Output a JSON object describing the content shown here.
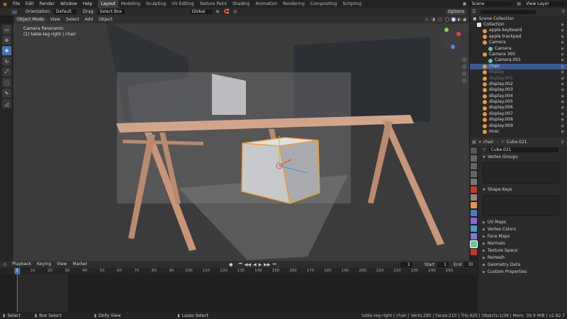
{
  "menubar": {
    "items": [
      "File",
      "Edit",
      "Render",
      "Window",
      "Help"
    ],
    "workspaces": [
      "Layout",
      "Modeling",
      "Sculpting",
      "UV Editing",
      "Texture Paint",
      "Shading",
      "Animation",
      "Rendering",
      "Compositing",
      "Scripting"
    ],
    "active_workspace": "Layout",
    "scene_label": "Scene",
    "view_layer_label": "View Layer"
  },
  "tool_header": {
    "orientation_label": "Orientation:",
    "orientation_value": "Default",
    "drag_label": "Drag:",
    "drag_value": "Select Box",
    "transform_orientation": "Global",
    "options_label": "Options"
  },
  "viewport_header": {
    "mode": "Object Mode",
    "menus": [
      "View",
      "Select",
      "Add",
      "Object"
    ]
  },
  "viewport": {
    "overlay_line1": "Camera Panoramic",
    "overlay_line2": "(1) table-leg-right | chair"
  },
  "toolbar": {
    "tools": [
      "select-box",
      "cursor",
      "move",
      "rotate",
      "scale",
      "transform",
      "annotate",
      "measure"
    ],
    "active_tool": "move"
  },
  "outliner": {
    "header": "Scene Collection",
    "items": [
      {
        "label": "Collection",
        "depth": 0,
        "icon": "collection",
        "color": "#e8e8e8"
      },
      {
        "label": "apple keyboard",
        "depth": 1,
        "icon": "mesh",
        "color": "#e69646"
      },
      {
        "label": "apple trackpad",
        "depth": 1,
        "icon": "mesh",
        "color": "#e69646"
      },
      {
        "label": "Camera",
        "depth": 1,
        "icon": "camera",
        "color": "#e69646"
      },
      {
        "label": "Camera",
        "depth": 2,
        "icon": "camera-data",
        "color": "#62c8a0"
      },
      {
        "label": "Camera 360",
        "depth": 1,
        "icon": "camera",
        "color": "#e69646"
      },
      {
        "label": "Camera.001",
        "depth": 2,
        "icon": "camera-data",
        "color": "#62c8a0"
      },
      {
        "label": "chair",
        "depth": 1,
        "icon": "mesh",
        "color": "#e69646",
        "selected": true
      },
      {
        "label": "display",
        "depth": 1,
        "icon": "mesh",
        "color": "#e69646",
        "dim": true
      },
      {
        "label": "display.001",
        "depth": 1,
        "icon": "mesh",
        "color": "#e69646",
        "dim": true
      },
      {
        "label": "display.002",
        "depth": 1,
        "icon": "mesh",
        "color": "#e69646"
      },
      {
        "label": "display.003",
        "depth": 1,
        "icon": "mesh",
        "color": "#e69646"
      },
      {
        "label": "display.004",
        "depth": 1,
        "icon": "mesh",
        "color": "#e69646"
      },
      {
        "label": "display.005",
        "depth": 1,
        "icon": "mesh",
        "color": "#e69646"
      },
      {
        "label": "display.006",
        "depth": 1,
        "icon": "mesh",
        "color": "#e69646"
      },
      {
        "label": "display.007",
        "depth": 1,
        "icon": "mesh",
        "color": "#e69646"
      },
      {
        "label": "display.008",
        "depth": 1,
        "icon": "mesh",
        "color": "#e69646"
      },
      {
        "label": "display.009",
        "depth": 1,
        "icon": "mesh",
        "color": "#e69646"
      },
      {
        "label": "imac",
        "depth": 1,
        "icon": "mesh",
        "color": "#e69646"
      }
    ]
  },
  "properties": {
    "object_name": "chair",
    "mesh_name": "Cube.021",
    "datablock_name": "Cube.021",
    "panels": [
      "Vertex Groups",
      "Shape Keys",
      "UV Maps",
      "Vertex Colors",
      "Face Maps",
      "Normals",
      "Texture Space",
      "Remesh",
      "Geometry Data",
      "Custom Properties"
    ]
  },
  "timeline": {
    "menus": [
      "Playback",
      "Keying",
      "View",
      "Marker"
    ],
    "current_frame": "1",
    "start_label": "Start",
    "start_value": "1",
    "end_label": "End",
    "end_value": "30",
    "ticks": [
      "1",
      "10",
      "20",
      "30",
      "40",
      "50",
      "60",
      "70",
      "80",
      "90",
      "100",
      "110",
      "120",
      "130",
      "140",
      "150",
      "160",
      "170",
      "180",
      "190",
      "200",
      "210",
      "220",
      "230",
      "240",
      "250"
    ]
  },
  "statusbar": {
    "select_label": "Select",
    "box_select_label": "Box Select",
    "dolly_label": "Dolly View",
    "lasso_label": "Lasso Select",
    "stats": "table-leg-right | chair | Verts:280 | Faces:210 | Tris:420 | Objects:1/38 | Mem: 39.9 MiB | v2.82.7"
  },
  "colors": {
    "accent": "#4772b3",
    "selected_outline": "#f59a22",
    "mesh_icon": "#e69646",
    "data_icon": "#62c8a0"
  }
}
